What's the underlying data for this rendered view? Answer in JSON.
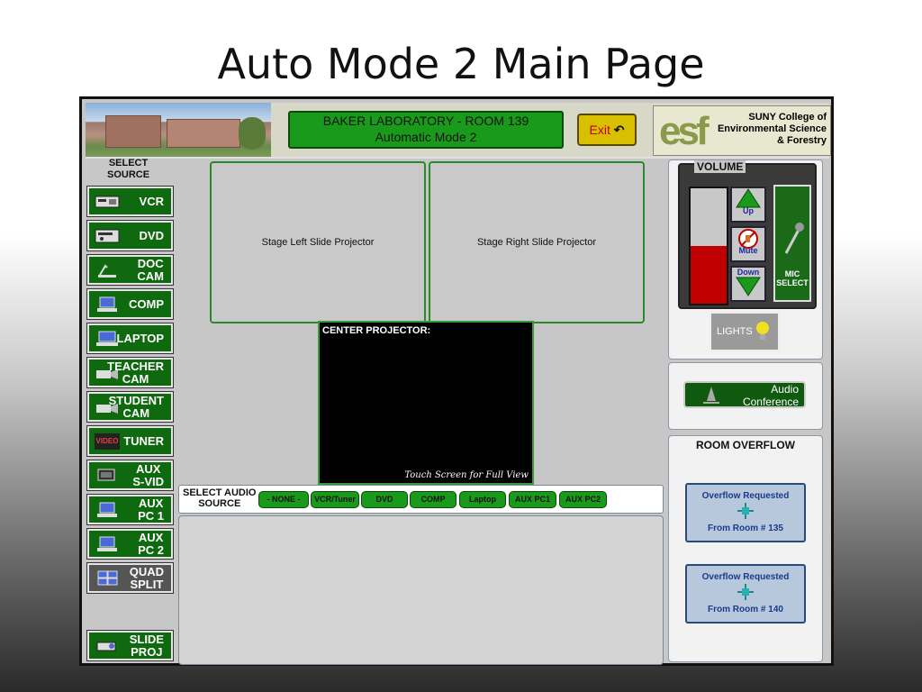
{
  "slide_title": "Auto Mode 2 Main Page",
  "header": {
    "room_line1": "BAKER LABORATORY - ROOM 139",
    "room_line2": "Automatic Mode 2",
    "exit_label": "Exit",
    "logo_mark": "esf",
    "logo_line1": "SUNY College of",
    "logo_line2": "Environmental  Science",
    "logo_line3": "& Forestry"
  },
  "source": {
    "label_line1": "SELECT",
    "label_line2": "SOURCE",
    "buttons": [
      {
        "line1": "VCR",
        "line2": "",
        "icon": "vcr-icon"
      },
      {
        "line1": "DVD",
        "line2": "",
        "icon": "dvd-icon"
      },
      {
        "line1": "DOC",
        "line2": "CAM",
        "icon": "doc-cam-icon"
      },
      {
        "line1": "COMP",
        "line2": "",
        "icon": "computer-icon"
      },
      {
        "line1": "LAPTOP",
        "line2": "",
        "icon": "laptop-icon"
      },
      {
        "line1": "TEACHER",
        "line2": "CAM",
        "icon": "camera-icon"
      },
      {
        "line1": "STUDENT",
        "line2": "CAM",
        "icon": "camera-icon"
      },
      {
        "line1": "TUNER",
        "line2": "",
        "icon": "video-icon"
      },
      {
        "line1": "AUX",
        "line2": "S-VID",
        "icon": "svid-icon"
      },
      {
        "line1": "AUX",
        "line2": "PC 1",
        "icon": "computer-icon"
      },
      {
        "line1": "AUX",
        "line2": "PC 2",
        "icon": "computer-icon"
      },
      {
        "line1": "QUAD",
        "line2": "SPLIT",
        "icon": "quad-split-icon"
      },
      {
        "line1": "SLIDE",
        "line2": "PROJ",
        "icon": "slide-projector-icon"
      }
    ],
    "tuner_icon_text": "VIDEO"
  },
  "projectors": {
    "left": "Stage Left Slide Projector",
    "right": "Stage Right Slide Projector",
    "center_label": "CENTER PROJECTOR:",
    "center_hint": "Touch Screen for Full View"
  },
  "audio": {
    "label_line1": "SELECT AUDIO",
    "label_line2": "SOURCE",
    "buttons": [
      "- NONE -",
      "VCR/Tuner",
      "DVD",
      "COMP",
      "Laptop",
      "AUX PC1",
      "AUX PC2"
    ]
  },
  "volume": {
    "title": "VOLUME",
    "level_percent": 50,
    "up_label": "Up",
    "mute_label": "Mute",
    "down_label": "Down",
    "mic_line1": "MIC",
    "mic_line2": "SELECT"
  },
  "lights_label": "LIGHTS",
  "audio_conference": {
    "line1": "Audio",
    "line2": "Conference"
  },
  "overflow": {
    "title": "ROOM OVERFLOW",
    "requests": [
      {
        "status": "Overflow Requested",
        "from": "From Room # 135"
      },
      {
        "status": "Overflow Requested",
        "from": "From Room # 140"
      }
    ]
  },
  "colors": {
    "button_green": "#0f6a0f",
    "accent_green": "#1a9a1a",
    "exit_yellow": "#d8c000",
    "meter_red": "#c00000",
    "overflow_blue": "#1a3a8a"
  }
}
